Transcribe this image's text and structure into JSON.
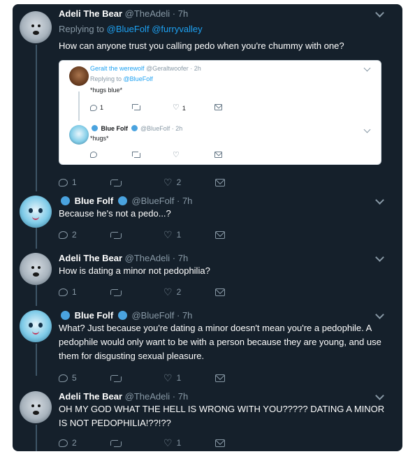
{
  "colors": {
    "background": "#15202b",
    "link": "#1da1f2",
    "muted": "#8899a6",
    "verified": "#4aa3df"
  },
  "tweets": [
    {
      "name": "Adeli The Bear",
      "handle": "@TheAdeli",
      "time": "· 7h",
      "replying_prefix": "Replying to",
      "mention1": "@BlueFolf",
      "mention2": "@furryvalley",
      "text": "How can anyone trust you calling pedo when you're chummy with one?",
      "replies": "1",
      "likes": "2",
      "quoted": [
        {
          "name": "Geralt the werewolf",
          "handle": "@Geraltwoofer",
          "time": "· 2h",
          "replying_prefix": "Replying to",
          "mention": "@BlueFolf",
          "text": "*hugs blue*",
          "replies": "1",
          "likes": "1"
        },
        {
          "name": "Blue Folf",
          "handle": "@BlueFolf",
          "time": "· 2h",
          "text": "*hugs*"
        }
      ]
    },
    {
      "name": "Blue Folf",
      "handle": "@BlueFolf",
      "time": "· 7h",
      "text": "Because he's not a pedo...?",
      "replies": "2",
      "likes": "1"
    },
    {
      "name": "Adeli The Bear",
      "handle": "@TheAdeli",
      "time": "· 7h",
      "text": "How is dating a minor not pedophilia?",
      "replies": "1",
      "likes": "2"
    },
    {
      "name": "Blue Folf",
      "handle": "@BlueFolf",
      "time": "· 7h",
      "text": "What? Just because you're dating a minor doesn't mean you're a pedophile. A pedophile would only want to be with a person because they are young, and use them for disgusting sexual pleasure.",
      "replies": "5",
      "likes": "1"
    },
    {
      "name": "Adeli The Bear",
      "handle": "@TheAdeli",
      "time": "· 7h",
      "text": "OH MY GOD WHAT THE HELL IS WRONG WITH YOU????? DATING A MINOR IS NOT PEDOPHILIA!??!??",
      "replies": "2",
      "likes": "1"
    }
  ]
}
